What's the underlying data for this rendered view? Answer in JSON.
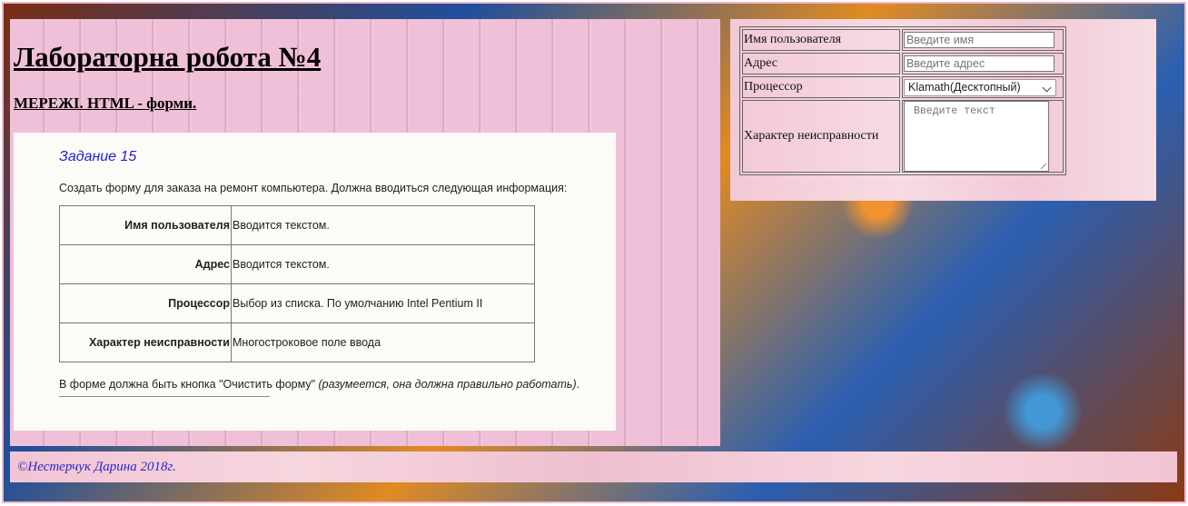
{
  "header": {
    "title": "Лабораторна робота №4",
    "subtitle": "МЕРЕЖІ. HTML - форми."
  },
  "task": {
    "title": "Задание 15",
    "description": "Создать форму для заказа на ремонт компьютера. Должна вводиться следующая информация:",
    "rows": [
      {
        "field": "Имя пользователя",
        "desc": "Вводится текстом."
      },
      {
        "field": "Адрес",
        "desc": "Вводится текстом."
      },
      {
        "field": "Процессор",
        "desc": "Выбор из списка. По умолчанию Intel Pentium II"
      },
      {
        "field": "Характер неисправности",
        "desc": "Многостроковое поле ввода"
      }
    ],
    "note_main": "В форме должна быть кнопка \"Очистить форму\" ",
    "note_italic": "(разумеется, она должна правильно работать)",
    "note_end": "."
  },
  "form": {
    "name_label": "Имя пользователя",
    "name_placeholder": "Введите имя",
    "address_label": "Адрес",
    "address_placeholder": "Введите адрес",
    "processor_label": "Процессор",
    "processor_selected": "Klamath(Десктопный)",
    "fault_label": "Характер неисправности",
    "fault_placeholder": "Введите текст"
  },
  "footer": {
    "text": "©Нестерчук Дарина 2018г."
  },
  "colors": {
    "link_blue": "#2828c8",
    "panel_pink": "#f0c0d8",
    "task_bg": "#fdfbf7"
  }
}
